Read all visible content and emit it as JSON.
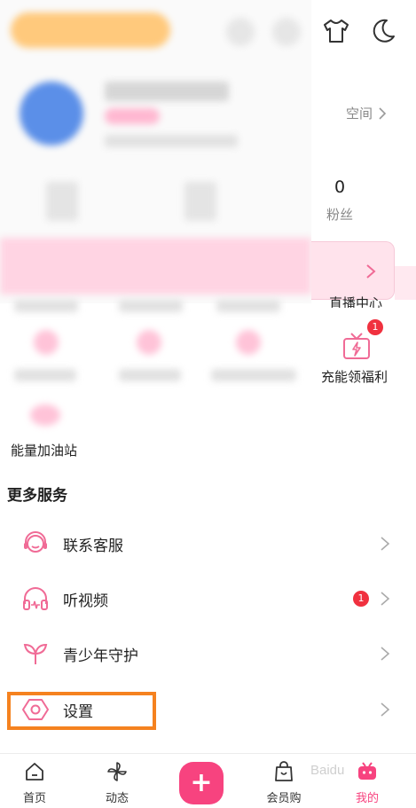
{
  "header": {
    "shirt_icon": "tshirt-icon",
    "theme_icon": "moon-icon"
  },
  "profile": {
    "space_label": "空间",
    "fans_count": "0",
    "fans_label": "粉丝"
  },
  "grid": {
    "live_center_label": "直播中心",
    "gift_label": "充能领福利",
    "gift_badge": "1",
    "energy_label": "能量加油站"
  },
  "services": {
    "title": "更多服务",
    "items": [
      {
        "label": "联系客服",
        "icon": "headset-icon"
      },
      {
        "label": "听视频",
        "icon": "headphones-icon",
        "badge": "1"
      },
      {
        "label": "青少年守护",
        "icon": "sprout-icon"
      },
      {
        "label": "设置",
        "icon": "settings-icon"
      }
    ]
  },
  "nav": {
    "items": [
      {
        "label": "首页",
        "icon": "home-icon"
      },
      {
        "label": "动态",
        "icon": "pinwheel-icon"
      },
      {
        "label": "",
        "icon": "plus-icon"
      },
      {
        "label": "会员购",
        "icon": "shopping-bag-icon"
      },
      {
        "label": "我的",
        "icon": "tv-icon"
      }
    ]
  },
  "colors": {
    "accent": "#f7437f",
    "icon_pink": "#f06b96",
    "badge_red": "#f0313f",
    "highlight_orange": "#f5821f"
  },
  "watermark": "Baidu"
}
